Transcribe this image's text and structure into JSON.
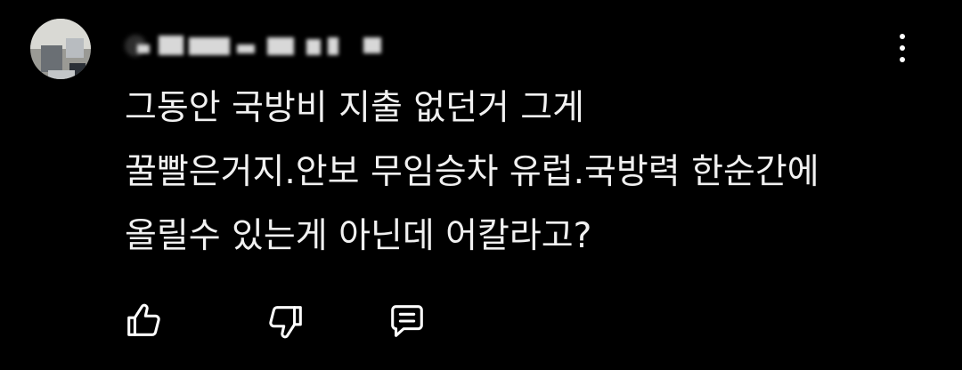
{
  "comment": {
    "author": "@",
    "avatar_icon": "user-avatar",
    "text_lines": [
      "그동안 국방비 지출 없던거 그게",
      "꿀빨은거지.안보 무임승차 유럽.국방력 한순간에",
      "올릴수 있는게 아닌데 어칼라고?"
    ],
    "actions": {
      "like_icon": "thumbs-up-icon",
      "dislike_icon": "thumbs-down-icon",
      "reply_icon": "reply-comment-icon"
    },
    "more_icon": "more-vertical-icon"
  }
}
